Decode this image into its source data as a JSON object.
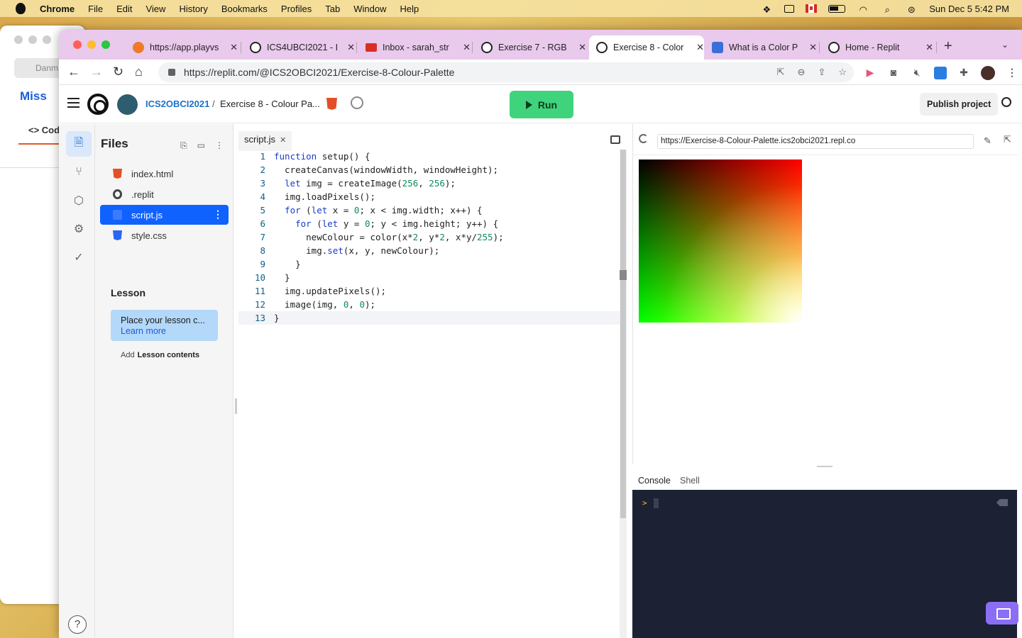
{
  "menubar": {
    "app": "Chrome",
    "items": [
      "File",
      "Edit",
      "View",
      "History",
      "Bookmarks",
      "Profiles",
      "Tab",
      "Window",
      "Help"
    ],
    "datetime": "Sun Dec 5  5:42 PM"
  },
  "background_window": {
    "tab_label": "Danm",
    "title": "Miss",
    "code_label": "<> Cod"
  },
  "tabs": [
    {
      "title": "https://app.playvs",
      "color": "#f07a2a"
    },
    {
      "title": "ICS4UBCI2021 - I",
      "color": "#222222"
    },
    {
      "title": "Inbox - sarah_str",
      "color": "#d93025"
    },
    {
      "title": "Exercise 7 - RGB",
      "color": "#222222"
    },
    {
      "title": "Exercise 8 - Color",
      "color": "#222222"
    },
    {
      "title": "What is a Color P",
      "color": "#3a6fd8"
    },
    {
      "title": "Home - Replit",
      "color": "#222222"
    }
  ],
  "url": "https://replit.com/@ICS2OBCI2021/Exercise-8-Colour-Palette",
  "replit": {
    "team": "ICS2OBCI2021",
    "project": "Exercise 8 - Colour Pa...",
    "run_label": "Run",
    "publish_label": "Publish project",
    "accent": "#3fd47c"
  },
  "files": {
    "title": "Files",
    "items": [
      {
        "name": "index.html",
        "type": "html"
      },
      {
        "name": ".replit",
        "type": "replit"
      },
      {
        "name": "script.js",
        "type": "js"
      },
      {
        "name": "style.css",
        "type": "css"
      }
    ],
    "lesson_title": "Lesson",
    "lesson_text": "Place your lesson c...",
    "lesson_link": "Learn more",
    "add_label": "Add",
    "add_bold": "Lesson contents"
  },
  "editor": {
    "tab": "script.js",
    "lines": [
      [
        {
          "t": "function",
          "c": "kw"
        },
        {
          "t": " setup() {",
          "c": "fn"
        }
      ],
      [
        {
          "t": "  createCanvas(windowWidth, windowHeight);",
          "c": "fn"
        }
      ],
      [
        {
          "t": "  ",
          "c": "fn"
        },
        {
          "t": "let",
          "c": "kw"
        },
        {
          "t": " img = createImage(",
          "c": "fn"
        },
        {
          "t": "256",
          "c": "num"
        },
        {
          "t": ", ",
          "c": "fn"
        },
        {
          "t": "256",
          "c": "num"
        },
        {
          "t": ");",
          "c": "fn"
        }
      ],
      [
        {
          "t": "  img.loadPixels();",
          "c": "fn"
        }
      ],
      [
        {
          "t": "  ",
          "c": "fn"
        },
        {
          "t": "for",
          "c": "kw"
        },
        {
          "t": " (",
          "c": "fn"
        },
        {
          "t": "let",
          "c": "kw"
        },
        {
          "t": " x = ",
          "c": "fn"
        },
        {
          "t": "0",
          "c": "num"
        },
        {
          "t": "; x < img.width; x++) {",
          "c": "fn"
        }
      ],
      [
        {
          "t": "    ",
          "c": "fn"
        },
        {
          "t": "for",
          "c": "kw"
        },
        {
          "t": " (",
          "c": "fn"
        },
        {
          "t": "let",
          "c": "kw"
        },
        {
          "t": " y = ",
          "c": "fn"
        },
        {
          "t": "0",
          "c": "num"
        },
        {
          "t": "; y < img.height; y++) {",
          "c": "fn"
        }
      ],
      [
        {
          "t": "      newColour = color(x*",
          "c": "fn"
        },
        {
          "t": "2",
          "c": "num"
        },
        {
          "t": ", y*",
          "c": "fn"
        },
        {
          "t": "2",
          "c": "num"
        },
        {
          "t": ", x*y/",
          "c": "fn"
        },
        {
          "t": "255",
          "c": "num"
        },
        {
          "t": ");",
          "c": "fn"
        }
      ],
      [
        {
          "t": "      img.",
          "c": "fn"
        },
        {
          "t": "set",
          "c": "kw"
        },
        {
          "t": "(x, y, newColour);",
          "c": "fn"
        }
      ],
      [
        {
          "t": "    }",
          "c": "fn"
        }
      ],
      [
        {
          "t": "  }",
          "c": "fn"
        }
      ],
      [
        {
          "t": "  img.updatePixels();",
          "c": "fn"
        }
      ],
      [
        {
          "t": "  image(img, ",
          "c": "fn"
        },
        {
          "t": "0",
          "c": "num"
        },
        {
          "t": ", ",
          "c": "fn"
        },
        {
          "t": "0",
          "c": "num"
        },
        {
          "t": ");",
          "c": "fn"
        }
      ],
      [
        {
          "t": "}",
          "c": "fn"
        }
      ]
    ],
    "current_line": 13
  },
  "webview": {
    "url": "https://Exercise-8-Colour-Palette.ics2obci2021.repl.co"
  },
  "console": {
    "tabs": [
      "Console",
      "Shell"
    ],
    "active_tab": "Console",
    "prompt": ">"
  }
}
